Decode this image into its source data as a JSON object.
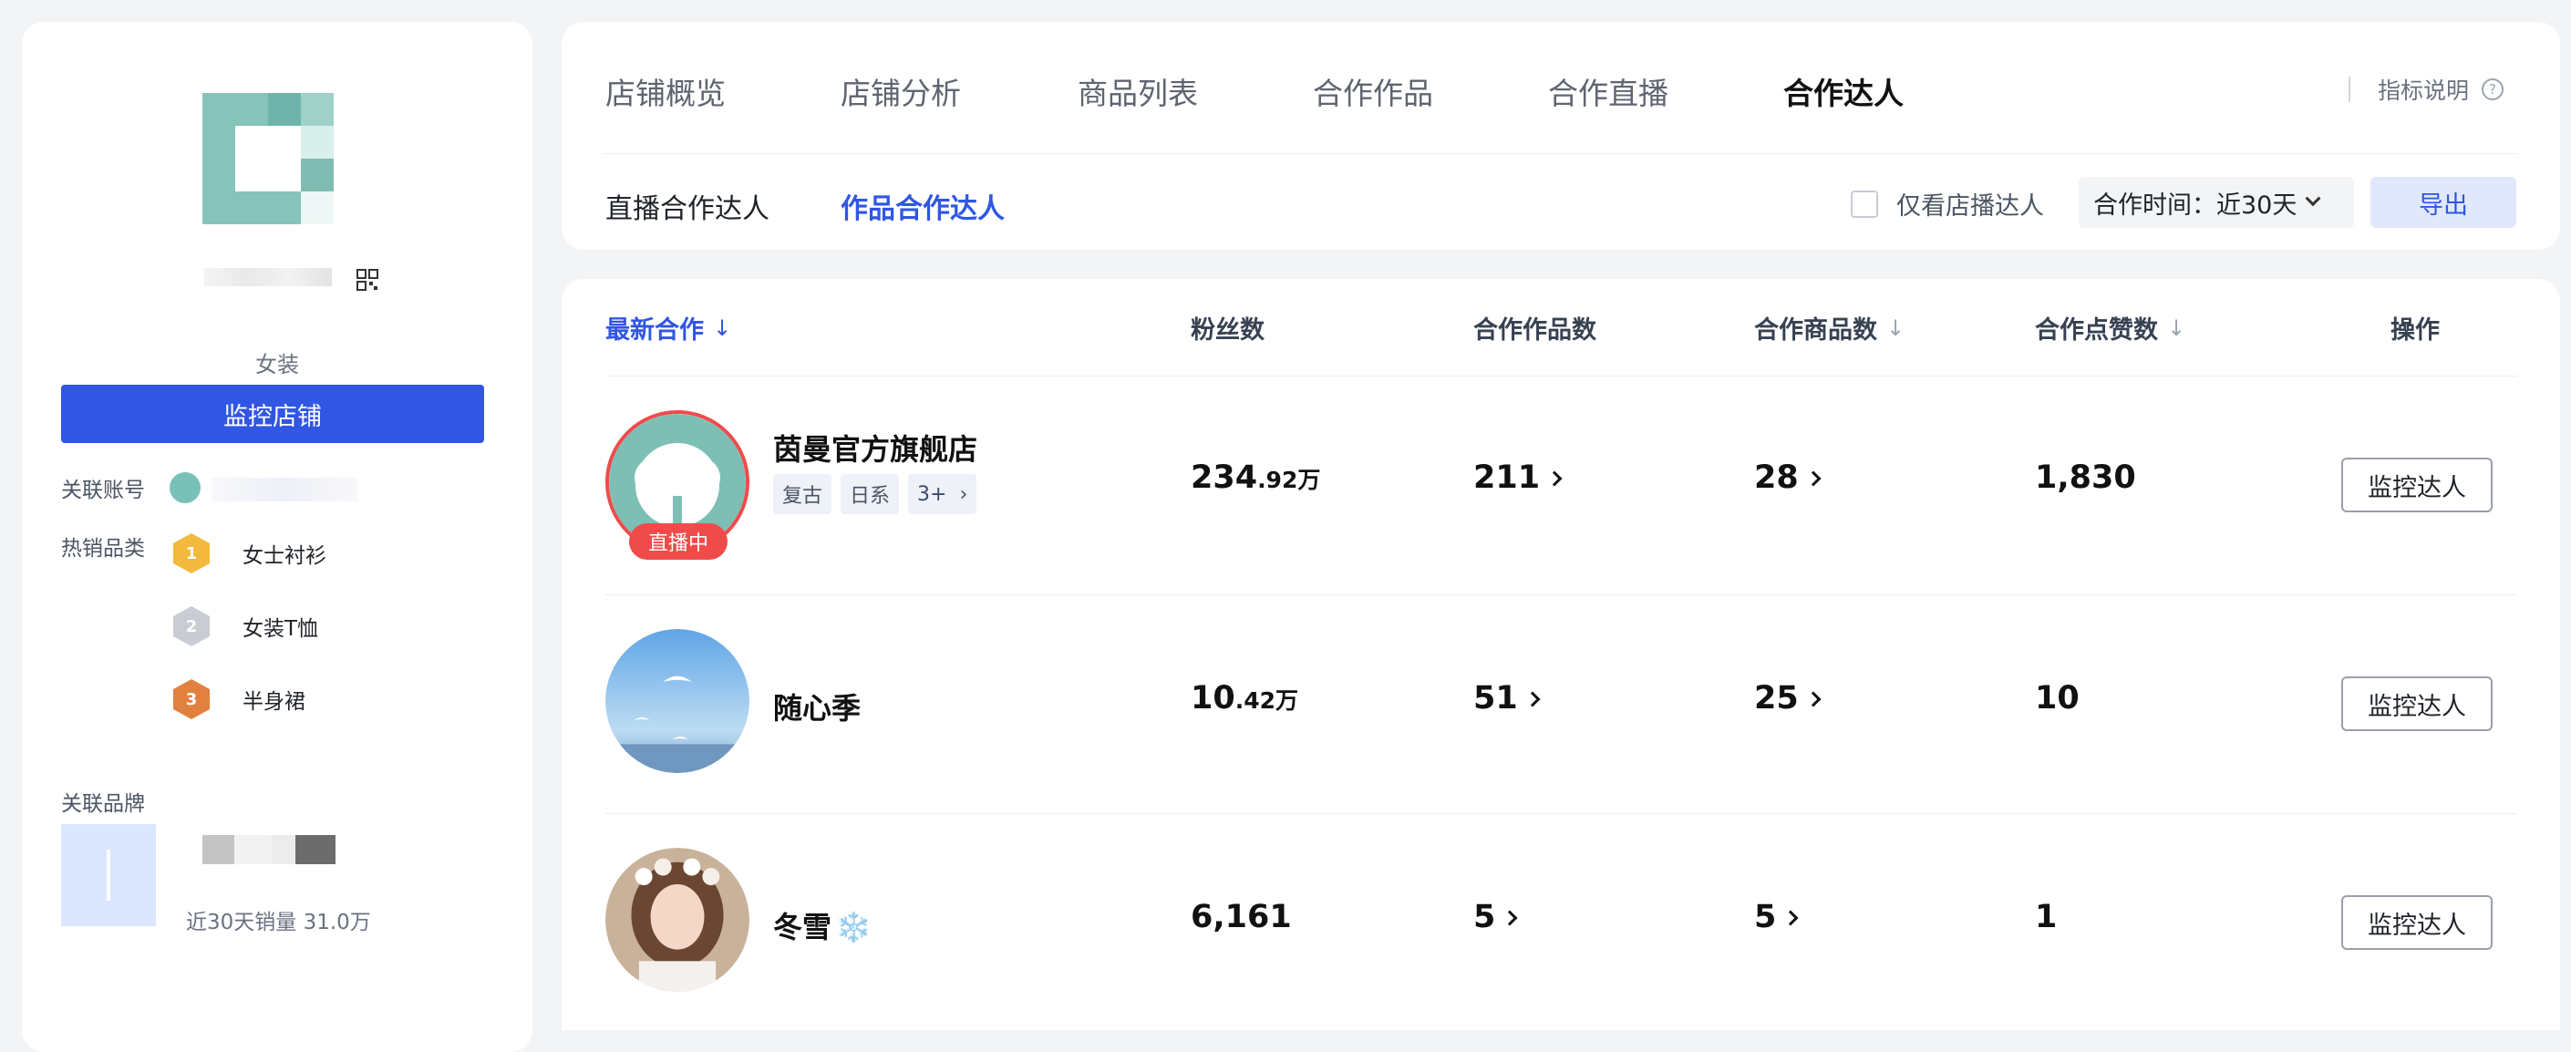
{
  "shop": {
    "category": "女装",
    "monitor_label": "监控店铺",
    "linked_account_label": "关联账号",
    "hot_category_label": "热销品类",
    "hot_categories": [
      {
        "rank": "1",
        "name": "女士衬衫"
      },
      {
        "rank": "2",
        "name": "女装T恤"
      },
      {
        "rank": "3",
        "name": "半身裙"
      }
    ],
    "linked_brand_label": "关联品牌",
    "brand_sales": "近30天销量 31.0万"
  },
  "tabs": [
    "店铺概览",
    "店铺分析",
    "商品列表",
    "合作作品",
    "合作直播",
    "合作达人"
  ],
  "active_tab": "合作达人",
  "metric_help": "指标说明",
  "subtabs": [
    "直播合作达人",
    "作品合作达人"
  ],
  "active_subtab": "作品合作达人",
  "filters": {
    "only_store_label": "仅看店播达人",
    "coop_time_label": "合作时间：近30天",
    "export_label": "导出"
  },
  "table": {
    "headers": [
      "最新合作",
      "粉丝数",
      "合作作品数",
      "合作商品数",
      "合作点赞数",
      "操作"
    ],
    "sort_arrow": "↓",
    "rows": [
      {
        "name": "茵曼官方旗舰店",
        "live": "直播中",
        "tags": [
          "复古",
          "日系",
          "3+"
        ],
        "fans_main": "234",
        "fans_small": ".92万",
        "works": "211",
        "goods": "28",
        "likes": "1,830",
        "action": "监控达人"
      },
      {
        "name": "随心季",
        "fans_main": "10",
        "fans_small": ".42万",
        "works": "51",
        "goods": "25",
        "likes": "10",
        "action": "监控达人"
      },
      {
        "name": "冬雪",
        "emoji": "❄️",
        "fans_main": "6,161",
        "fans_small": "",
        "works": "5",
        "goods": "5",
        "likes": "1",
        "action": "监控达人"
      }
    ]
  },
  "colors": {
    "accent": "#3056e3",
    "live": "#ef4b4b"
  }
}
